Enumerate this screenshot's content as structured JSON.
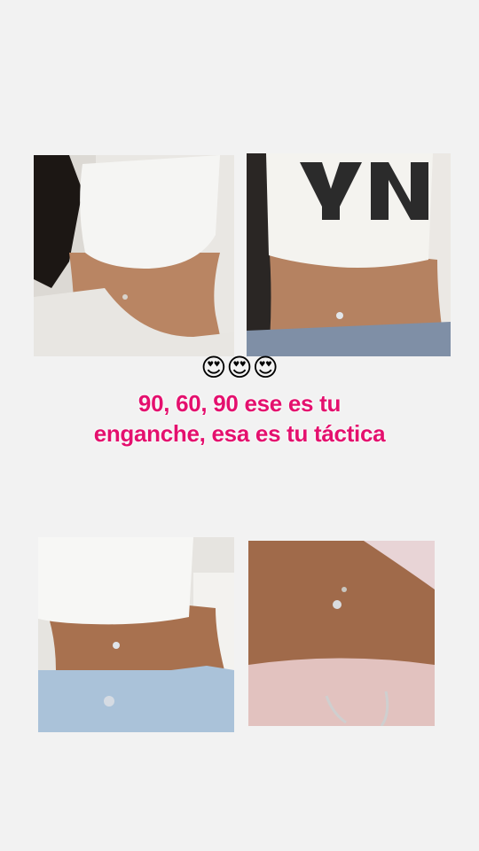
{
  "story": {
    "emojis": "😍😍😍",
    "caption": "90, 60, 90 ese es tu enganche, esa es tu táctica"
  },
  "colors": {
    "background": "#f2f2f2",
    "caption": "#e4106e"
  }
}
